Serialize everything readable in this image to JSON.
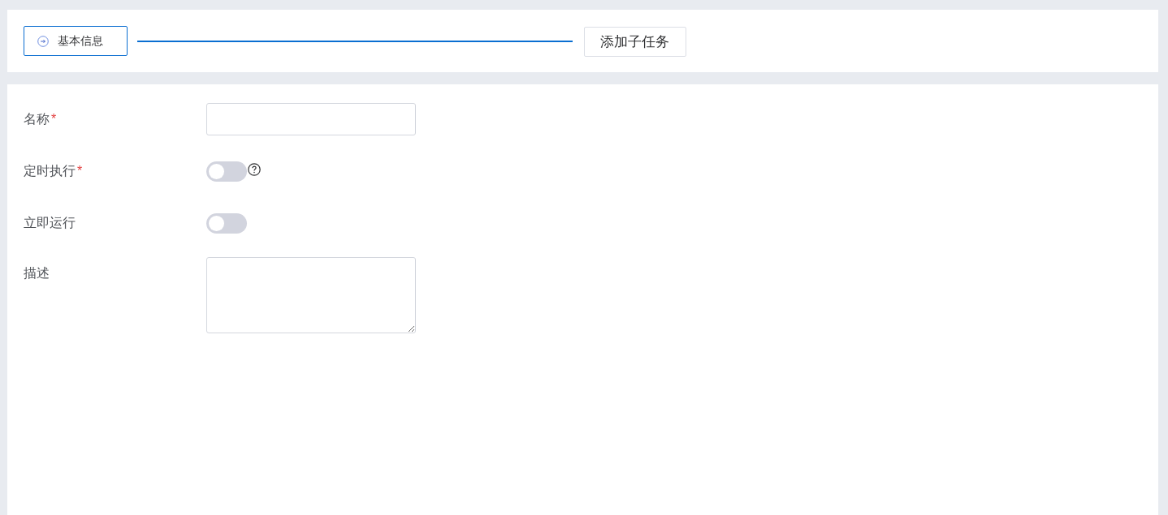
{
  "steps": [
    {
      "label": "基本信息",
      "selected": true,
      "icon": true
    },
    {
      "label": "添加子任务",
      "selected": false,
      "icon": false
    }
  ],
  "form": {
    "fields": [
      {
        "kind": "text",
        "label": "名称",
        "required_mark": "*"
      },
      {
        "kind": "switch",
        "label": "定时执行",
        "required_mark": "*",
        "on": false,
        "help": true
      },
      {
        "kind": "switch",
        "label": "立即运行",
        "on": false,
        "help": false
      },
      {
        "kind": "textarea",
        "label": "描述"
      }
    ]
  }
}
